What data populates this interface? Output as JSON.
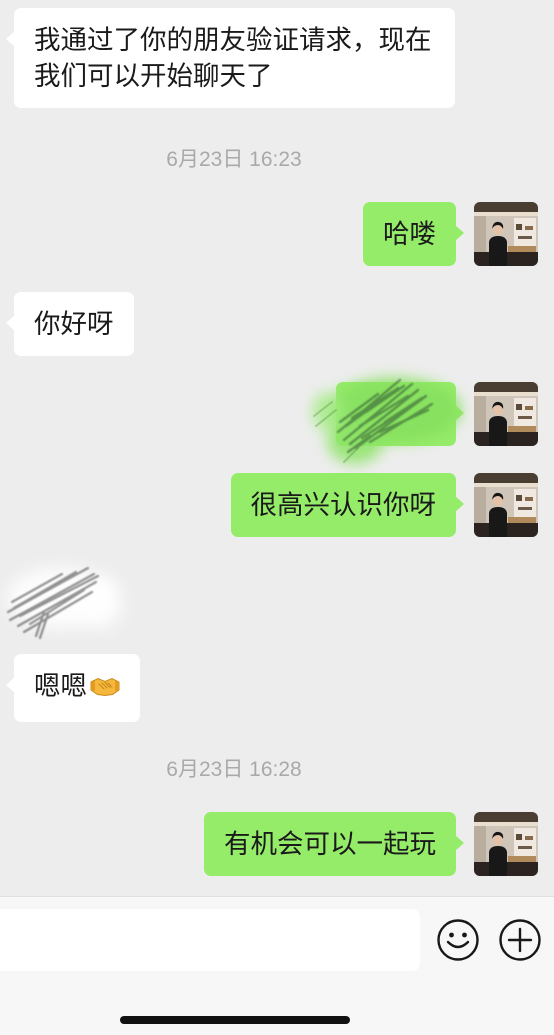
{
  "colors": {
    "background": "#ededed",
    "my_bubble": "#95ec69",
    "their_bubble": "#ffffff",
    "text": "#1a1a1a",
    "timestamp": "#a9a9a9",
    "input_bar": "#f7f7f7"
  },
  "chat": {
    "timestamps": [
      "6月23日 16:23",
      "6月23日 16:28"
    ],
    "messages": [
      {
        "sender": "them",
        "text": "我通过了你的朋友验证请求，现在我们可以开始聊天了"
      },
      {
        "sender": "me",
        "text": "哈喽",
        "avatar": "my-avatar"
      },
      {
        "sender": "them",
        "text": "你好呀"
      },
      {
        "sender": "me",
        "avatar": "my-avatar",
        "overlay_icon": "scribble-redaction-icon"
      },
      {
        "sender": "me",
        "text": "很高兴认识你呀",
        "avatar": "my-avatar"
      },
      {
        "sender": "them",
        "overlay_icon": "scribble-redaction-icon"
      },
      {
        "sender": "them",
        "text": "嗯嗯",
        "emoji": "handshake-emoji-icon"
      },
      {
        "sender": "me",
        "text": "有机会可以一起玩",
        "avatar": "my-avatar"
      }
    ]
  },
  "input_bar": {
    "value": "",
    "emoji_button_icon": "smiley-face-icon",
    "more_button_icon": "plus-circle-icon"
  }
}
